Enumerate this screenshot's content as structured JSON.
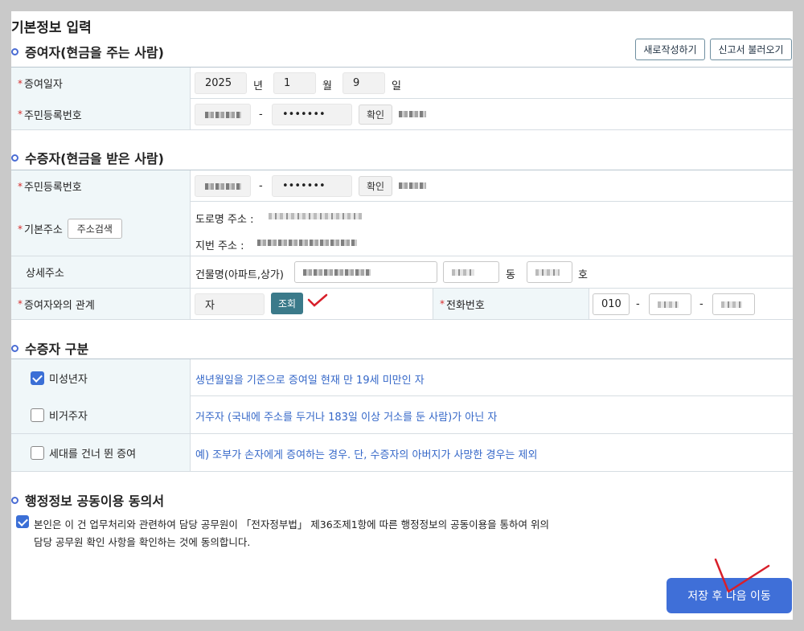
{
  "page_title": "기본정보 입력",
  "donor": {
    "section_title": "증여자(현금을 주는 사람)",
    "new_button": "새로작성하기",
    "load_button": "신고서 불러오기",
    "date_label": "증여일자",
    "year": "2025",
    "year_unit": "년",
    "month": "1",
    "month_unit": "월",
    "day": "9",
    "day_unit": "일",
    "rrn_label": "주민등록번호",
    "rrn_dash": "-",
    "rrn_back": "•••••••",
    "confirm_button": "확인"
  },
  "recipient": {
    "section_title": "수증자(현금을 받은 사람)",
    "rrn_label": "주민등록번호",
    "rrn_dash": "-",
    "rrn_back": "•••••••",
    "confirm_button": "확인",
    "address_label": "기본주소",
    "address_search_button": "주소검색",
    "road_address_label": "도로명 주소 :",
    "lot_address_label": "지번 주소 :",
    "detail_label": "상세주소",
    "building_label": "건물명(아파트,상가)",
    "dong_unit": "동",
    "ho_unit": "호",
    "relation_label": "증여자와의 관계",
    "relation_value": "자",
    "lookup_button": "조회",
    "phone_label": "전화번호",
    "phone_prefix": "010",
    "phone_dash": "-"
  },
  "classification": {
    "section_title": "수증자 구분",
    "items": [
      {
        "label": "미성년자",
        "checked": true,
        "desc": "생년월일을 기준으로 증여일 현재 만 19세 미만인 자"
      },
      {
        "label": "비거주자",
        "checked": false,
        "desc": "거주자 (국내에 주소를 두거나 183일 이상 거소를 둔 사람)가 아닌 자"
      },
      {
        "label": "세대를 건너 뛴 증여",
        "checked": false,
        "desc": "예) 조부가 손자에게 증여하는 경우. 단, 수증자의 아버지가 사망한 경우는 제외"
      }
    ]
  },
  "consent": {
    "section_title": "행정정보 공동이용 동의서",
    "checked": true,
    "line1": "본인은 이 건 업무처리와 관련하여 담당 공무원이 「전자정부법」 제36조제1항에 따른 행정정보의 공동이용을 통하여 위의",
    "line2": "담당 공무원 확인 사항을 확인하는 것에 동의합니다."
  },
  "save_button": "저장 후 다음 이동",
  "colors": {
    "accent": "#3f6fd8",
    "label_bg": "#f0f7f9",
    "required": "#d62b2b",
    "annotation": "#d81f2a"
  }
}
